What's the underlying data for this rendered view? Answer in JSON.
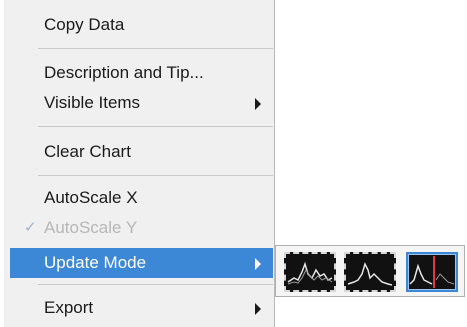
{
  "menu": {
    "items": [
      {
        "label": "Copy Data"
      },
      {
        "label": "Description and Tip..."
      },
      {
        "label": "Visible Items"
      },
      {
        "label": "Clear Chart"
      },
      {
        "label": "AutoScale X"
      },
      {
        "label": "AutoScale Y",
        "checked": true,
        "disabled": true
      },
      {
        "label": "Update Mode",
        "highlighted": true
      },
      {
        "label": "Export"
      }
    ],
    "check_glyph": "✓"
  },
  "submenu": {
    "update_modes": [
      {
        "name": "strip-chart-icon"
      },
      {
        "name": "scope-chart-icon"
      },
      {
        "name": "sweep-chart-icon",
        "selected": true
      }
    ]
  },
  "colors": {
    "highlight": "#3c88d7",
    "menu_bg": "#f0f0f0",
    "disabled_text": "#b7b7b7"
  }
}
